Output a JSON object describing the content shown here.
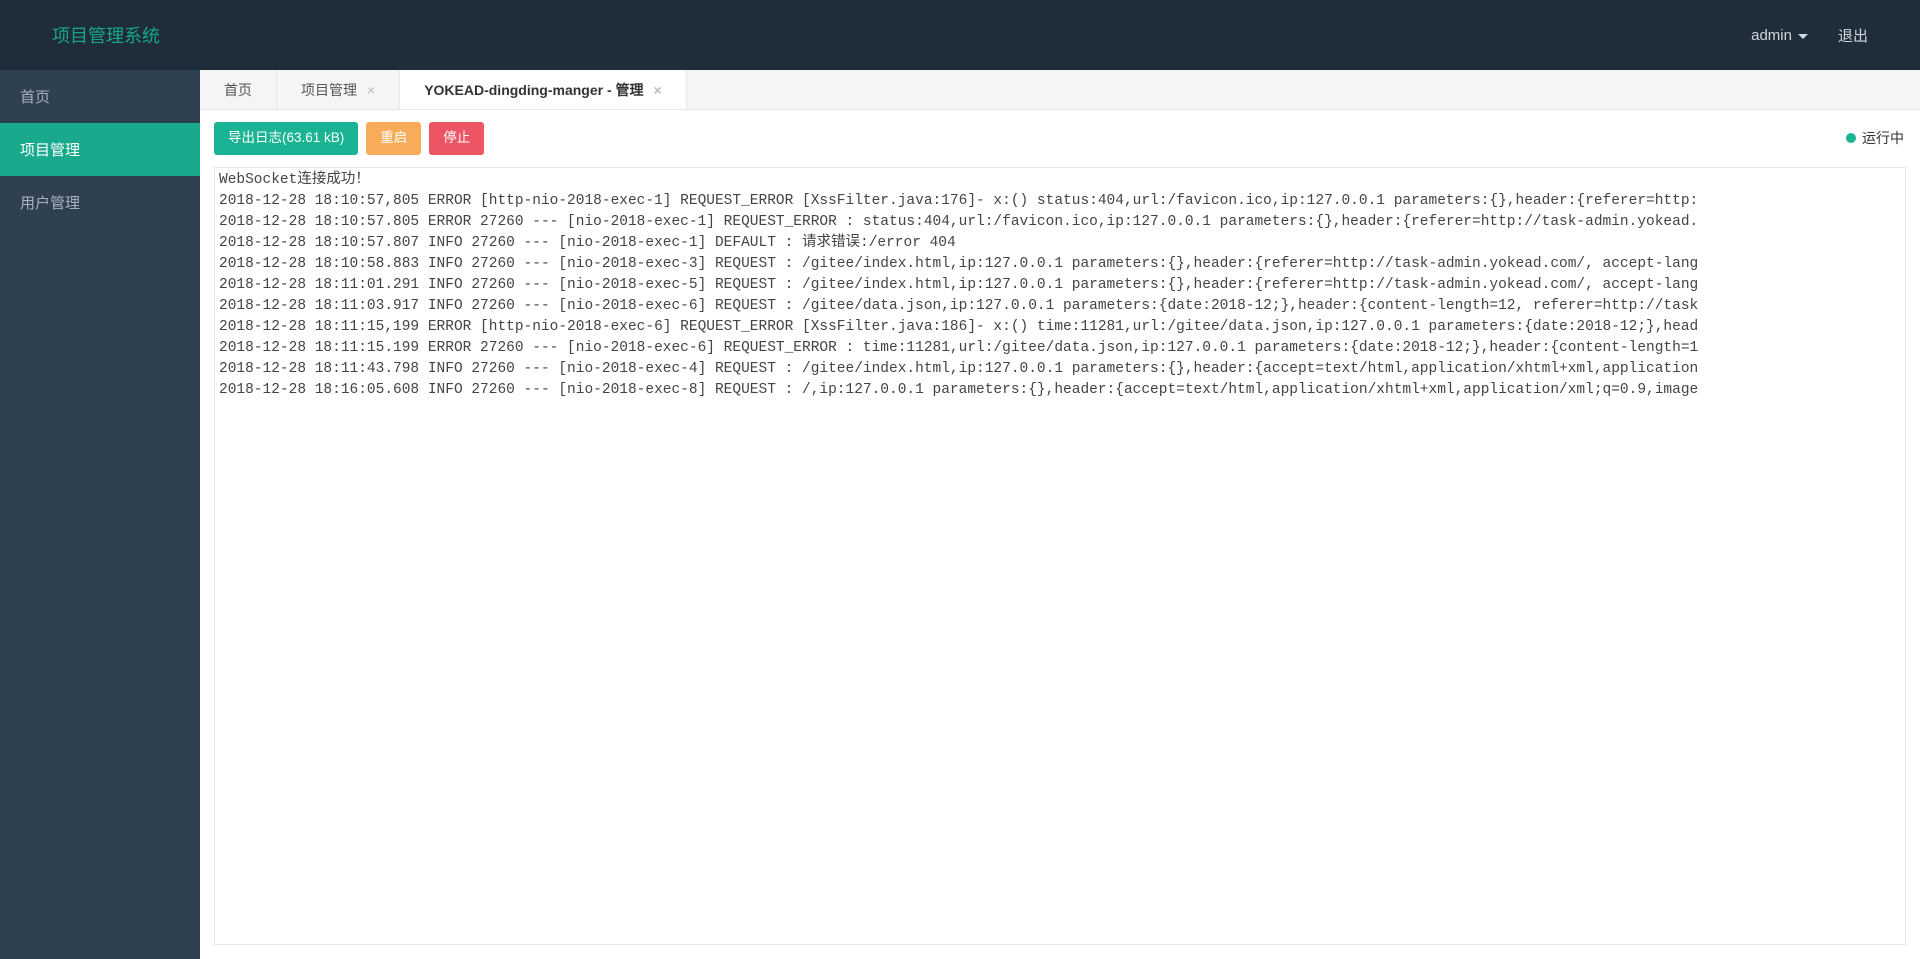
{
  "header": {
    "brand": "项目管理系统",
    "user": "admin",
    "logout": "退出"
  },
  "sidebar": {
    "items": [
      {
        "label": "首页",
        "active": false
      },
      {
        "label": "项目管理",
        "active": true
      },
      {
        "label": "用户管理",
        "active": false
      }
    ]
  },
  "tabs": [
    {
      "label": "首页",
      "closable": false,
      "active": false
    },
    {
      "label": "项目管理",
      "closable": true,
      "active": false
    },
    {
      "label": "YOKEAD-dingding-manger - 管理",
      "closable": true,
      "active": true
    }
  ],
  "toolbar": {
    "export_label": "导出日志(63.61 kB)",
    "restart_label": "重启",
    "stop_label": "停止"
  },
  "status": {
    "text": "运行中"
  },
  "log_lines": [
    "WebSocket连接成功！",
    "2018-12-28 18:10:57,805 ERROR [http-nio-2018-exec-1] REQUEST_ERROR [XssFilter.java:176]- x:() status:404,url:/favicon.ico,ip:127.0.0.1 parameters:{},header:{referer=http:",
    "2018-12-28 18:10:57.805 ERROR 27260 --- [nio-2018-exec-1] REQUEST_ERROR : status:404,url:/favicon.ico,ip:127.0.0.1 parameters:{},header:{referer=http://task-admin.yokead.",
    "2018-12-28 18:10:57.807 INFO 27260 --- [nio-2018-exec-1] DEFAULT : 请求错误:/error 404",
    "2018-12-28 18:10:58.883 INFO 27260 --- [nio-2018-exec-3] REQUEST : /gitee/index.html,ip:127.0.0.1 parameters:{},header:{referer=http://task-admin.yokead.com/, accept-lang",
    "2018-12-28 18:11:01.291 INFO 27260 --- [nio-2018-exec-5] REQUEST : /gitee/index.html,ip:127.0.0.1 parameters:{},header:{referer=http://task-admin.yokead.com/, accept-lang",
    "2018-12-28 18:11:03.917 INFO 27260 --- [nio-2018-exec-6] REQUEST : /gitee/data.json,ip:127.0.0.1 parameters:{date:2018-12;},header:{content-length=12, referer=http://task",
    "2018-12-28 18:11:15,199 ERROR [http-nio-2018-exec-6] REQUEST_ERROR [XssFilter.java:186]- x:() time:11281,url:/gitee/data.json,ip:127.0.0.1 parameters:{date:2018-12;},head",
    "2018-12-28 18:11:15.199 ERROR 27260 --- [nio-2018-exec-6] REQUEST_ERROR : time:11281,url:/gitee/data.json,ip:127.0.0.1 parameters:{date:2018-12;},header:{content-length=1",
    "2018-12-28 18:11:43.798 INFO 27260 --- [nio-2018-exec-4] REQUEST : /gitee/index.html,ip:127.0.0.1 parameters:{},header:{accept=text/html,application/xhtml+xml,application",
    "2018-12-28 18:16:05.608 INFO 27260 --- [nio-2018-exec-8] REQUEST : /,ip:127.0.0.1 parameters:{},header:{accept=text/html,application/xhtml+xml,application/xml;q=0.9,image"
  ]
}
